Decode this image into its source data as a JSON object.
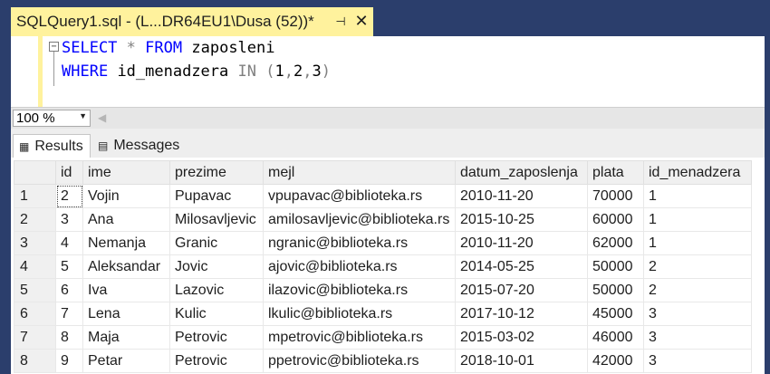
{
  "tab": {
    "title": "SQLQuery1.sql - (L...DR64EU1\\Dusa (52))*",
    "pin_icon": "⊣",
    "close_icon": "✕"
  },
  "editor": {
    "collapse_symbol": "−",
    "line1": {
      "kw1": "SELECT",
      "star": "*",
      "kw2": "FROM",
      "table": "zaposleni"
    },
    "line2": {
      "kw1": "WHERE",
      "column": "id_menadzera",
      "kw2": "IN",
      "open": "(",
      "v1": "1",
      "c1": ",",
      "v2": "2",
      "c2": ",",
      "v3": "3",
      "close": ")"
    }
  },
  "zoom": {
    "value": "100 %"
  },
  "results_tabs": {
    "results_label": "Results",
    "messages_label": "Messages"
  },
  "grid": {
    "columns": [
      "id",
      "ime",
      "prezime",
      "mejl",
      "datum_zaposlenja",
      "plata",
      "id_menadzera"
    ],
    "rows": [
      {
        "n": "1",
        "id": "2",
        "ime": "Vojin",
        "prezime": "Pupavac",
        "mejl": "vpupavac@biblioteka.rs",
        "datum": "2010-11-20",
        "plata": "70000",
        "idm": "1"
      },
      {
        "n": "2",
        "id": "3",
        "ime": "Ana",
        "prezime": "Milosavljevic",
        "mejl": "amilosavljevic@biblioteka.rs",
        "datum": "2015-10-25",
        "plata": "60000",
        "idm": "1"
      },
      {
        "n": "3",
        "id": "4",
        "ime": "Nemanja",
        "prezime": "Granic",
        "mejl": "ngranic@biblioteka.rs",
        "datum": "2010-11-20",
        "plata": "62000",
        "idm": "1"
      },
      {
        "n": "4",
        "id": "5",
        "ime": "Aleksandar",
        "prezime": "Jovic",
        "mejl": "ajovic@biblioteka.rs",
        "datum": "2014-05-25",
        "plata": "50000",
        "idm": "2"
      },
      {
        "n": "5",
        "id": "6",
        "ime": "Iva",
        "prezime": "Lazovic",
        "mejl": "ilazovic@biblioteka.rs",
        "datum": "2015-07-20",
        "plata": "50000",
        "idm": "2"
      },
      {
        "n": "6",
        "id": "7",
        "ime": "Lena",
        "prezime": "Kulic",
        "mejl": "lkulic@biblioteka.rs",
        "datum": "2017-10-12",
        "plata": "45000",
        "idm": "3"
      },
      {
        "n": "7",
        "id": "8",
        "ime": "Maja",
        "prezime": "Petrovic",
        "mejl": "mpetrovic@biblioteka.rs",
        "datum": "2015-03-02",
        "plata": "46000",
        "idm": "3"
      },
      {
        "n": "8",
        "id": "9",
        "ime": "Petar",
        "prezime": "Petrovic",
        "mejl": "ppetrovic@biblioteka.rs",
        "datum": "2018-10-01",
        "plata": "42000",
        "idm": "3"
      }
    ]
  },
  "colors": {
    "accent_tab": "#fff29d",
    "chrome_dark": "#2b3e6c",
    "sql_keyword": "#0000ff",
    "sql_operator": "#808080"
  }
}
